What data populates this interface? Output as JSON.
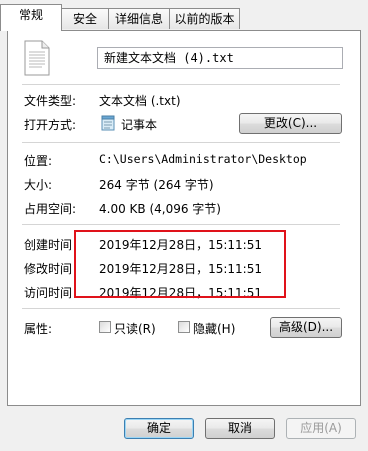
{
  "tabs": [
    {
      "label": "常规",
      "active": true
    },
    {
      "label": "安全",
      "active": false
    },
    {
      "label": "详细信息",
      "active": false
    },
    {
      "label": "以前的版本",
      "active": false
    }
  ],
  "file": {
    "name": "新建文本文档 (4).txt",
    "icon": "text-document-icon"
  },
  "properties": {
    "file_type_label": "文件类型:",
    "file_type_value": "文本文档 (.txt)",
    "opens_with_label": "打开方式:",
    "opens_with_value": "记事本",
    "opens_with_icon": "notepad-icon",
    "change_button": "更改(C)...",
    "location_label": "位置:",
    "location_value": "C:\\Users\\Administrator\\Desktop",
    "size_label": "大小:",
    "size_value": "264 字节 (264 字节)",
    "disk_size_label": "占用空间:",
    "disk_size_value": "4.00 KB (4,096 字节)",
    "created_label": "创建时间",
    "created_value": "2019年12月28日，15:11:51",
    "modified_label": "修改时间",
    "modified_value": "2019年12月28日，15:11:51",
    "accessed_label": "访问时间",
    "accessed_value": "2019年12月28日，15:11:51",
    "attributes_label": "属性:",
    "readonly_label": "只读(R)",
    "readonly_checked": false,
    "hidden_label": "隐藏(H)",
    "hidden_checked": false,
    "advanced_button": "高级(D)..."
  },
  "footer": {
    "ok": "确定",
    "cancel": "取消",
    "apply": "应用(A)"
  },
  "colors": {
    "highlight_box": "#e0121a"
  }
}
